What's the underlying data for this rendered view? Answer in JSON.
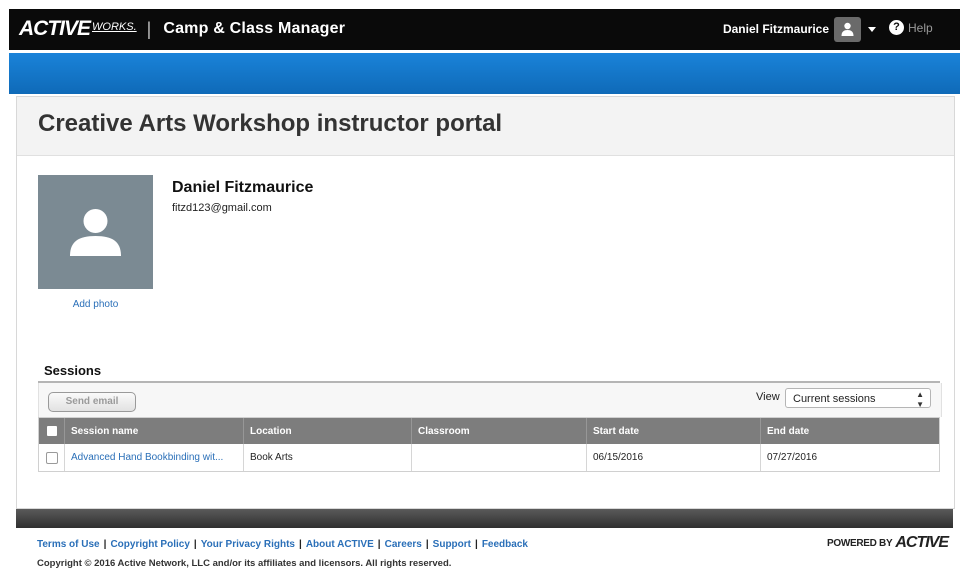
{
  "header": {
    "brand_name": "ACTIVE",
    "brand_suffix": "WORKS.",
    "separator": "|",
    "app_title": "Camp & Class Manager",
    "user_name": "Daniel Fitzmaurice",
    "help_label": "Help"
  },
  "page": {
    "title": "Creative Arts Workshop instructor portal"
  },
  "profile": {
    "name": "Daniel Fitzmaurice",
    "email": "fitzd123@gmail.com",
    "add_photo_label": "Add photo"
  },
  "sessions": {
    "heading": "Sessions",
    "send_email_label": "Send email",
    "view_label": "View",
    "view_selected": "Current sessions",
    "columns": [
      "Session name",
      "Location",
      "Classroom",
      "Start date",
      "End date"
    ],
    "rows": [
      {
        "session_name": "Advanced Hand Bookbinding wit...",
        "location": "Book Arts",
        "classroom": "",
        "start_date": "06/15/2016",
        "end_date": "07/27/2016"
      }
    ]
  },
  "footer": {
    "links": [
      "Terms of Use",
      "Copyright Policy",
      "Your Privacy Rights",
      "About ACTIVE",
      "Careers",
      "Support",
      "Feedback"
    ],
    "link_separator": "|",
    "copyright": "Copyright © 2016 Active Network, LLC and/or its affiliates and licensors. All rights reserved.",
    "powered_by": "POWERED BY",
    "powered_brand": "ACTIVE"
  },
  "colors": {
    "topbar": "#0a0a0a",
    "accent_blue": "#1a83d9",
    "link": "#2a6fb8",
    "table_header": "#7d7d7d"
  },
  "icons": [
    "user-icon",
    "caret-down-icon",
    "help-icon",
    "avatar-placeholder-icon",
    "select-arrows-icon"
  ]
}
